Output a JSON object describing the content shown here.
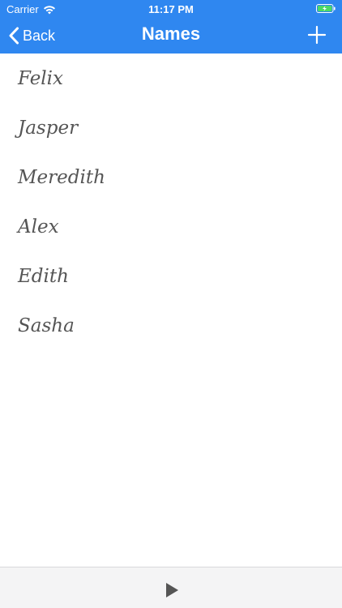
{
  "status_bar": {
    "carrier": "Carrier",
    "time": "11:17 PM",
    "wifi_icon": "wifi-icon",
    "battery_icon": "battery-charging-icon"
  },
  "navbar": {
    "back_label": "Back",
    "title": "Names",
    "back_icon": "chevron-left-icon",
    "add_icon": "plus-icon",
    "background_color": "#2f87f0"
  },
  "names": [
    "Felix",
    "Jasper",
    "Meredith",
    "Alex",
    "Edith",
    "Sasha"
  ],
  "toolbar": {
    "play_icon": "play-icon"
  }
}
